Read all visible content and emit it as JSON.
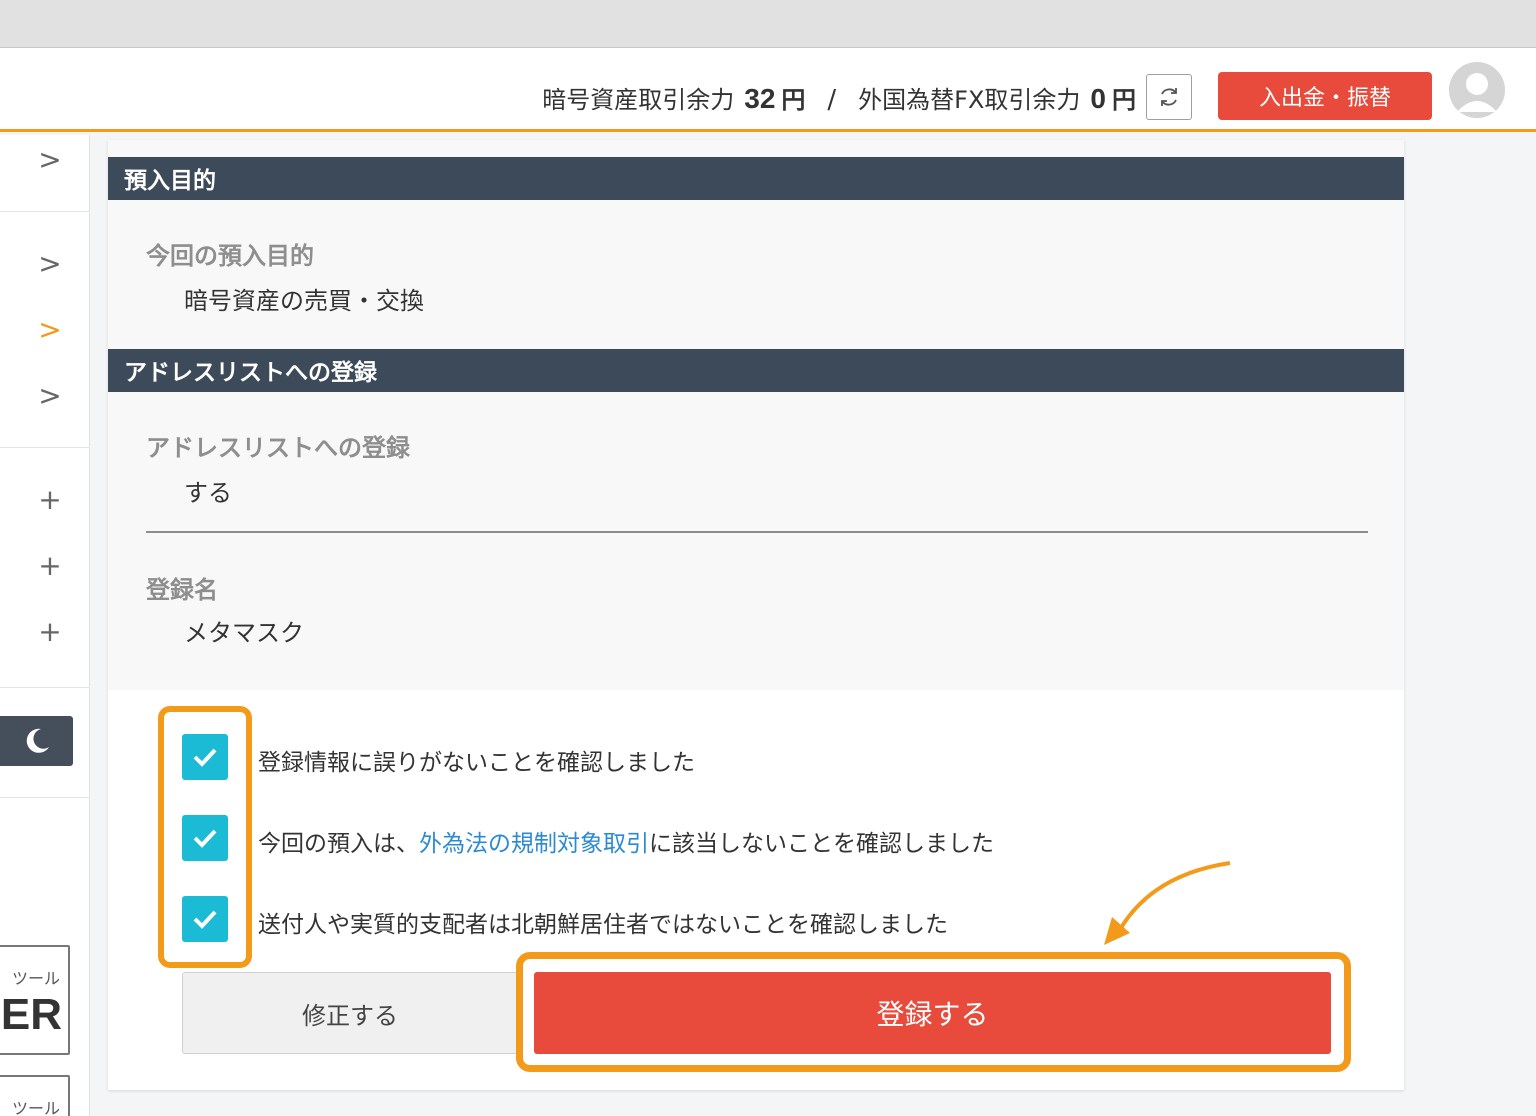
{
  "header": {
    "crypto_label": "暗号資産取引余力",
    "crypto_amount": "32",
    "crypto_unit": "円",
    "separator": "/",
    "fx_label": "外国為替FX取引余力",
    "fx_amount": "0",
    "fx_unit": "円",
    "deposit_button": "入出金・振替"
  },
  "sidebar": {
    "chevrons": [
      ">",
      ">",
      ">",
      ">"
    ],
    "pluses": [
      "+",
      "+",
      "+"
    ],
    "tool_small_1": "ツール",
    "tool_big_1": "ER",
    "tool_small_2": "ツール"
  },
  "sections": {
    "purpose": {
      "header": "預入目的",
      "label": "今回の預入目的",
      "value": "暗号資産の売買・交換"
    },
    "address_list": {
      "header": "アドレスリストへの登録",
      "label": "アドレスリストへの登録",
      "value": "する",
      "name_label": "登録名",
      "name_value": "メタマスク"
    }
  },
  "checks": {
    "c1": "登録情報に誤りがないことを確認しました",
    "c2_pre": "今回の預入は、",
    "c2_link": "外為法の規制対象取引",
    "c2_post": "に該当しないことを確認しました",
    "c3": "送付人や実質的支配者は北朝鮮居住者ではないことを確認しました"
  },
  "buttons": {
    "fix": "修正する",
    "register": "登録する"
  },
  "colors": {
    "accent_orange": "#f39a1b",
    "primary_red": "#e84b3c",
    "section_header": "#3d4a5a",
    "checkbox": "#1bbbd6",
    "link": "#2b8ad4"
  }
}
